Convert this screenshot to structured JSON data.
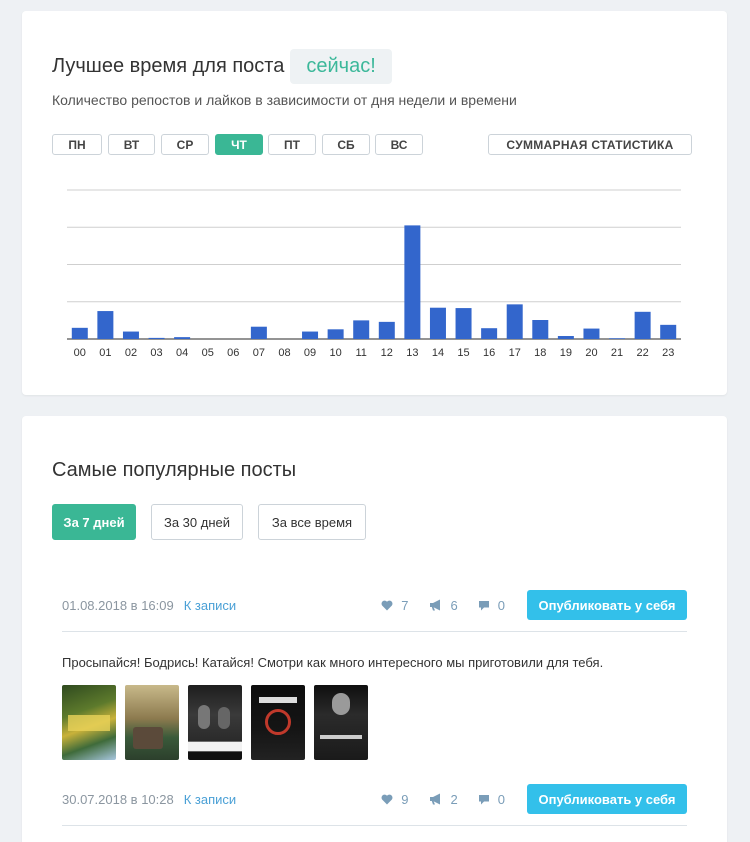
{
  "best_time": {
    "title": "Лучшее время для поста",
    "now_badge": "сейчас!",
    "subtitle": "Количество репостов и лайков в зависимости от дня недели и времени",
    "days": [
      "ПН",
      "ВТ",
      "СР",
      "ЧТ",
      "ПТ",
      "СБ",
      "ВС"
    ],
    "active_day": "ЧТ",
    "summary_label": "СУММАРНАЯ СТАТИСТИКА"
  },
  "chart_data": {
    "type": "bar",
    "categories": [
      "00",
      "01",
      "02",
      "03",
      "04",
      "05",
      "06",
      "07",
      "08",
      "09",
      "10",
      "11",
      "12",
      "13",
      "14",
      "15",
      "16",
      "17",
      "18",
      "19",
      "20",
      "21",
      "22",
      "23"
    ],
    "values": [
      3,
      7.5,
      2,
      0.3,
      0.5,
      0,
      0,
      3.3,
      0,
      2,
      2.6,
      5,
      4.6,
      30.5,
      8.4,
      8.3,
      2.9,
      9.3,
      5.1,
      0.8,
      2.8,
      0.2,
      7.3,
      3.8
    ],
    "title": "",
    "xlabel": "",
    "ylabel": "",
    "ylim": [
      0,
      40
    ],
    "grid": true,
    "color": "#3366cc"
  },
  "popular": {
    "title": "Самые популярные посты",
    "periods": [
      "За 7 дней",
      "За 30 дней",
      "За все время"
    ],
    "active_period": "За 7 дней",
    "posts": [
      {
        "date": "01.08.2018 в 16:09",
        "link": "К записи",
        "likes": "7",
        "reposts": "6",
        "comments": "0",
        "publish": "Опубликовать у себя",
        "text": "Просыпайся! Бодрись! Катайся! Смотри как много интересного мы приготовили для тебя.",
        "images": [
          "poster-1",
          "poster-2",
          "poster-3",
          "poster-4",
          "poster-5"
        ]
      },
      {
        "date": "30.07.2018 в 10:28",
        "link": "К записи",
        "likes": "9",
        "reposts": "2",
        "comments": "0",
        "publish": "Опубликовать у себя"
      }
    ]
  },
  "colors": {
    "accent": "#3ab795",
    "publish": "#33c0ea",
    "link": "#4aa0d6",
    "bar": "#3366cc"
  }
}
